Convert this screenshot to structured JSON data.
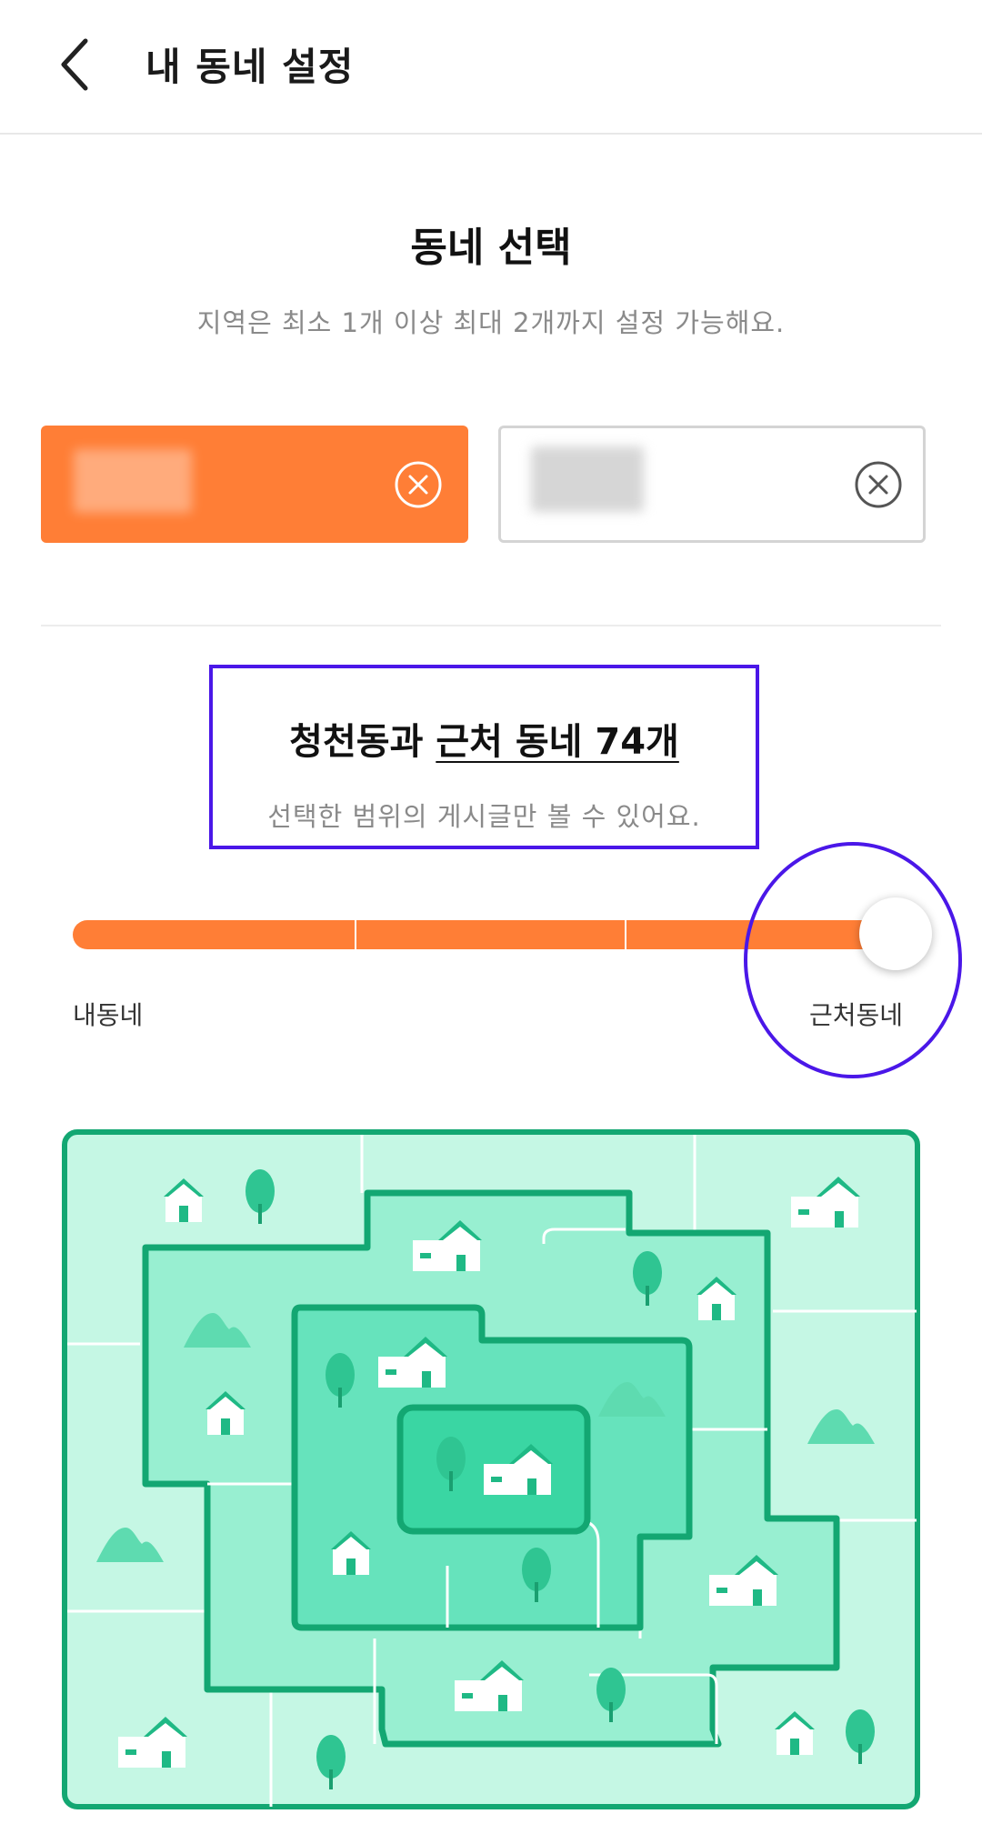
{
  "header": {
    "title": "내 동네 설정",
    "back_icon": "chevron-left-icon"
  },
  "selection": {
    "title": "동네 선택",
    "subtitle": "지역은 최소 1개 이상 최대 2개까지 설정 가능해요.",
    "chips": [
      {
        "state": "selected",
        "remove_icon": "close-circle-icon"
      },
      {
        "state": "unselected",
        "remove_icon": "close-circle-icon"
      }
    ]
  },
  "range": {
    "title_prefix": "청천동과 ",
    "title_link": "근처 동네 74개",
    "description": "선택한 범위의 게시글만 볼 수 있어요."
  },
  "slider": {
    "min_label": "내동네",
    "max_label": "근처동네",
    "steps": 4,
    "selected_step": 4
  },
  "colors": {
    "accent": "#ff7e36",
    "highlight": "#4a17e8",
    "map_outline": "#13a772",
    "map_light": "#c5f7e4",
    "map_mid": "#98efd1",
    "map_dark": "#66e3bc",
    "map_darkest": "#3ad6a3"
  }
}
